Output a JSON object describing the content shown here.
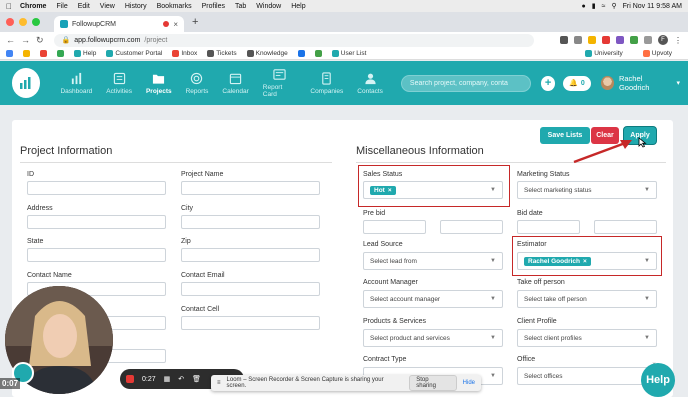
{
  "mac": {
    "app": "Chrome",
    "menus": [
      "File",
      "Edit",
      "View",
      "History",
      "Bookmarks",
      "Profiles",
      "Tab",
      "Window",
      "Help"
    ],
    "clock": "Fri Nov 11  9:58 AM"
  },
  "tab": {
    "title": "FollowupCRM"
  },
  "address": {
    "host": "app.followupcrm.com",
    "path": "/project"
  },
  "bookmarks": {
    "items": [
      "Help",
      "Customer Portal",
      "Inbox",
      "Tickets",
      "Knowledge",
      "User List"
    ],
    "right": [
      "University",
      "Upvoty"
    ]
  },
  "nav": {
    "items": [
      {
        "label": "Dashboard"
      },
      {
        "label": "Activities"
      },
      {
        "label": "Projects"
      },
      {
        "label": "Reports"
      },
      {
        "label": "Calendar"
      },
      {
        "label": "Report Card"
      },
      {
        "label": "Companies"
      },
      {
        "label": "Contacts"
      }
    ],
    "search_placeholder": "Search project, company, conta",
    "notifications": "0",
    "user": "Rachel Goodrich"
  },
  "actions": {
    "save": "Save Lists",
    "clear": "Clear",
    "apply": "Apply"
  },
  "project_info": {
    "title": "Project Information",
    "fields": {
      "id": "ID",
      "project_name": "Project Name",
      "address": "Address",
      "city": "City",
      "state": "State",
      "zip": "Zip",
      "contact_name": "Contact Name",
      "contact_email": "Contact Email",
      "contact_cell": "Contact Cell"
    }
  },
  "misc_info": {
    "title": "Miscellaneous Information",
    "sales_status": {
      "label": "Sales Status",
      "chip": "Hot"
    },
    "marketing_status": {
      "label": "Marketing Status",
      "placeholder": "Select marketing status"
    },
    "pre_bid": "Pre bid",
    "bid_date": "Bid date",
    "lead_source": {
      "label": "Lead Source",
      "placeholder": "Select lead from"
    },
    "estimator": {
      "label": "Estimator",
      "chip": "Rachel Goodrich"
    },
    "account_manager": {
      "label": "Account Manager",
      "placeholder": "Select account manager"
    },
    "take_off": {
      "label": "Take off person",
      "placeholder": "Select take off person"
    },
    "products": {
      "label": "Products & Services",
      "placeholder": "Select product and services"
    },
    "client_profile": {
      "label": "Client Profile",
      "placeholder": "Select client profiles"
    },
    "contract_type": {
      "label": "Contract Type"
    },
    "office": {
      "label": "Office",
      "placeholder": "Select offices"
    }
  },
  "recording": {
    "elapsed_left": "0:07",
    "elapsed": "0:27",
    "message": "Loom – Screen Recorder & Screen Capture is sharing your screen.",
    "stop": "Stop sharing",
    "hide": "Hide"
  },
  "help": "Help",
  "colors": {
    "brand": "#20a9ae",
    "danger": "#dc3545",
    "highlight": "#c62828"
  }
}
